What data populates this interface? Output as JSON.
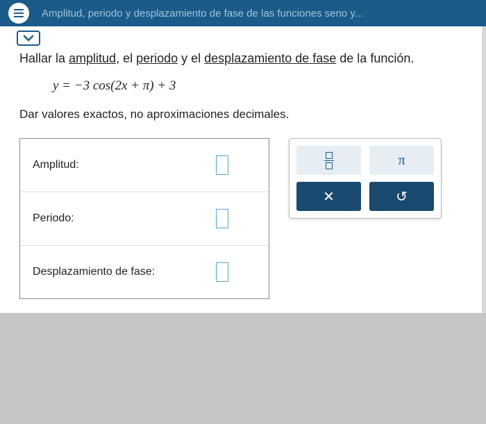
{
  "header": {
    "title": "Amplitud, periodo y desplazamiento de fase de las funciones seno y..."
  },
  "problem": {
    "instr_pre": "Hallar la ",
    "term1": "amplitud",
    "instr_mid1": ", el ",
    "term2": "periodo",
    "instr_mid2": " y el ",
    "term3": "desplazamiento de fase",
    "instr_post": " de la función.",
    "equation": "y = −3 cos(2x + π) + 3",
    "note": "Dar valores exactos, no aproximaciones decimales."
  },
  "answers": {
    "amp_label": "Amplitud:",
    "per_label": "Periodo:",
    "phase_label": "Desplazamiento de fase:"
  },
  "keypad": {
    "pi": "π",
    "close": "✕",
    "undo": "↺"
  }
}
